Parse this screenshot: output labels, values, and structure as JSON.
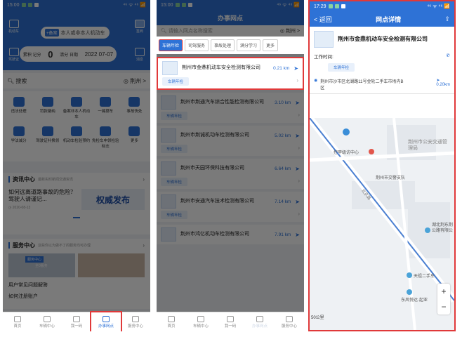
{
  "status_bar": {
    "time1": "15:00",
    "time2": "15:00",
    "time3": "17:29",
    "signal": "⁴⁶ ᯤ ⁴⁶ 📶"
  },
  "panel1": {
    "left_top_label": "机动车",
    "left_bottom_label": "驾驶证",
    "bind_pill_tag": "+备案",
    "bind_pill_text": "本人或非本人机动车",
    "right_top_label": "签到",
    "right_bottom_label": "消息",
    "score_label": "累积 记分",
    "score_value": "0",
    "cycle_label": "清分 日期",
    "cycle_value": "2022 07-07",
    "search_text": "搜索",
    "city": "荆州 >",
    "services": [
      "违法处理",
      "罚款缴纳",
      "备案非本人机动车",
      "一键挪车",
      "事故快处",
      "学法减分",
      "驾驶证补换领",
      "机动车检验预约",
      "免检车申领检验标志",
      "更多"
    ],
    "news_title": "资讯中心",
    "news_sub": "最新实时新闻交通资讯",
    "news_headline": "如何远离道路事故的危险？驾驶人请谨记...",
    "news_date": "2020-08-13",
    "news_banner": "权威发布",
    "service_title": "服务中心",
    "service_sub": "这些你以为做不了的服务均可办理",
    "service_badge": "服务中心",
    "service_badge2": "全0服务",
    "faq": "用户常见问题解答",
    "faq2": "如何注册账户"
  },
  "nav": [
    "首页",
    "车辆中心",
    "我一码",
    "办事网点",
    "服务中心"
  ],
  "panel2": {
    "title": "办事网点",
    "search_placeholder": "请输入网点名称搜索",
    "city": "荆州 >",
    "tabs": [
      "车辆年检",
      "司驾服务",
      "事故处理",
      "满分学习",
      "更多"
    ],
    "tag": "车辆年检",
    "items": [
      {
        "name": "荆州市金鼎机动车安全检测有限公司",
        "dist": "0.21 km"
      },
      {
        "name": "荆州市荆通汽车综合性能检测有限公司",
        "dist": "3.10 km"
      },
      {
        "name": "荆州市荆诚机动车检测有限公司",
        "dist": "5.02 km"
      },
      {
        "name": "荆州市天园环保科技有限公司",
        "dist": "6.64 km"
      },
      {
        "name": "荆州市安通汽车技术检测有限公司",
        "dist": "7.14 km"
      },
      {
        "name": "荆州市鸿亿机动车检测有限公司",
        "dist": "7.91 km"
      }
    ]
  },
  "panel3": {
    "back": "< 返回",
    "title": "网点详情",
    "name": "荆州市金鼎机动车安全检测有限公司",
    "hours_label": "工作时间:",
    "tag": "车辆年检",
    "address": "荆州市沙市区北湖路11号金轮二手车市场内B区",
    "dist": "0.20km",
    "map_labels": [
      "控甲级访中心",
      "荆州市公安交通管理局",
      "荆州市交警支队",
      "北京路",
      "湖北荆东荆公路有限公",
      "天祖二手车",
      "东风悦达·起亚"
    ],
    "scale": "50公里"
  },
  "colors": {
    "brand": "#2e72d6",
    "highlight": "#e0393a"
  }
}
